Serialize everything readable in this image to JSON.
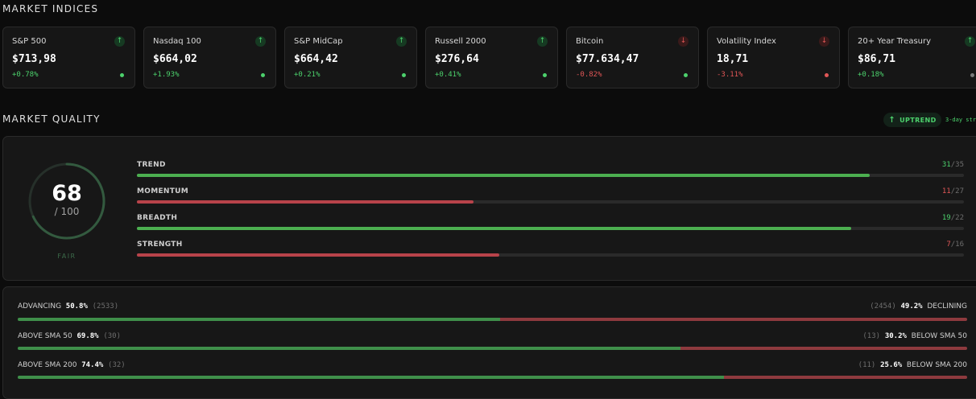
{
  "sections": {
    "indices_title": "MARKET INDICES",
    "quality_title": "MARKET QUALITY"
  },
  "indices": [
    {
      "name": "S&P 500",
      "value": "$713,98",
      "change": "+0.78%",
      "dir": "up",
      "status": "green"
    },
    {
      "name": "Nasdaq 100",
      "value": "$664,02",
      "change": "+1.93%",
      "dir": "up",
      "status": "green"
    },
    {
      "name": "S&P MidCap",
      "value": "$664,42",
      "change": "+0.21%",
      "dir": "up",
      "status": "green"
    },
    {
      "name": "Russell 2000",
      "value": "$276,64",
      "change": "+0.41%",
      "dir": "up",
      "status": "green"
    },
    {
      "name": "Bitcoin",
      "value": "$77.634,47",
      "change": "-0.82%",
      "dir": "down",
      "status": "green"
    },
    {
      "name": "Volatility Index",
      "value": "18,71",
      "change": "-3.11%",
      "dir": "down",
      "status": "red"
    },
    {
      "name": "20+ Year Treasury",
      "value": "$86,71",
      "change": "+0.18%",
      "dir": "up",
      "status": "gray"
    }
  ],
  "trend": {
    "badge": "UPTREND",
    "streak": "3-day stre"
  },
  "quality": {
    "score": "68",
    "max": "/ 100",
    "rating": "FAIR",
    "score_fraction": 0.68,
    "metrics": [
      {
        "label": "TREND",
        "num": "31",
        "den": "/35",
        "fraction": 0.886,
        "tone": "good"
      },
      {
        "label": "MOMENTUM",
        "num": "11",
        "den": "/27",
        "fraction": 0.407,
        "tone": "bad"
      },
      {
        "label": "BREADTH",
        "num": "19",
        "den": "/22",
        "fraction": 0.864,
        "tone": "good"
      },
      {
        "label": "STRENGTH",
        "num": "7",
        "den": "/16",
        "fraction": 0.438,
        "tone": "bad"
      }
    ]
  },
  "breadth": [
    {
      "left_label": "ADVANCING",
      "left_pct": "50.8%",
      "left_count": "(2533)",
      "right_count": "(2454)",
      "right_pct": "49.2%",
      "right_label": "DECLINING",
      "fraction": 0.508
    },
    {
      "left_label": "ABOVE  SMA 50",
      "left_pct": "69.8%",
      "left_count": "(30)",
      "right_count": "(13)",
      "right_pct": "30.2%",
      "right_label": "BELOW  SMA 50",
      "fraction": 0.698
    },
    {
      "left_label": "ABOVE  SMA 200",
      "left_pct": "74.4%",
      "left_count": "(32)",
      "right_count": "(11)",
      "right_pct": "25.6%",
      "right_label": "BELOW  SMA 200",
      "fraction": 0.744
    }
  ],
  "colors": {
    "positive": "#4cd16c",
    "negative": "#e05656",
    "neutral": "#7a7a7a",
    "accent_green": "#4caf50",
    "accent_red": "#b8434a"
  },
  "icons": {
    "up": "arrow-up-icon",
    "down": "arrow-down-icon"
  }
}
